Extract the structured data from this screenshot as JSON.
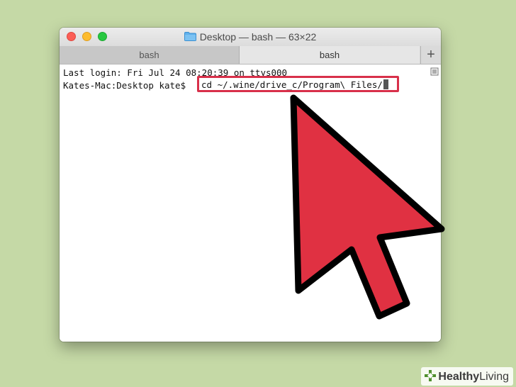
{
  "window": {
    "title": "Desktop — bash — 63×22"
  },
  "tabs": [
    {
      "label": "bash",
      "active": false
    },
    {
      "label": "bash",
      "active": true
    }
  ],
  "new_tab_label": "+",
  "terminal": {
    "line1": "Last login: Fri Jul 24 08:20:39 on ttys000",
    "prompt": "Kates-Mac:Desktop kate$ ",
    "command": "cd ~/.wine/drive_c/Program\\ Files/"
  },
  "watermark": {
    "brand_part1": "Healthy",
    "brand_part2": "Living"
  },
  "colors": {
    "arrow": "#e03142",
    "highlight": "#d8304a",
    "background": "#c5d9a6"
  },
  "icons": [
    "folder-icon",
    "new-tab-icon",
    "scroll-icon",
    "pointer-arrow-icon",
    "healthy-living-logo-icon"
  ]
}
